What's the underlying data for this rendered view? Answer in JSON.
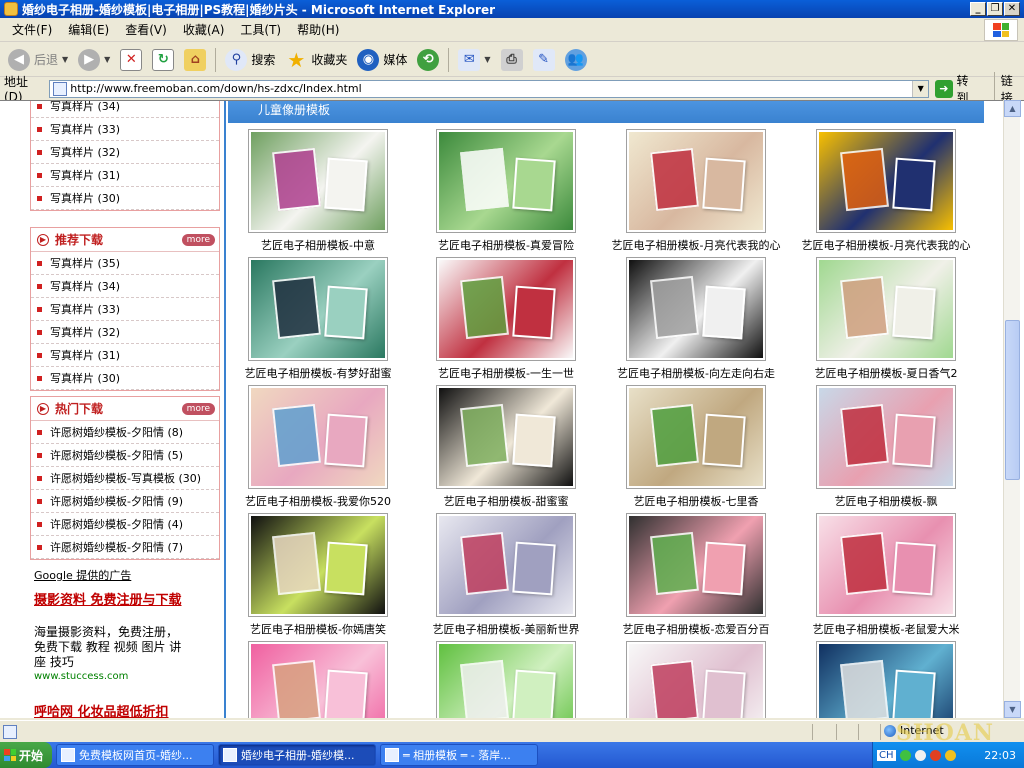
{
  "window": {
    "title": "婚纱电子相册-婚纱模板|电子相册|PS教程|婚纱片头 - Microsoft Internet Explorer",
    "min": "_",
    "max": "❐",
    "close": "✕"
  },
  "menu": [
    "文件(F)",
    "编辑(E)",
    "查看(V)",
    "收藏(A)",
    "工具(T)",
    "帮助(H)"
  ],
  "toolbar": {
    "back": "后退",
    "search": "搜索",
    "favorites": "收藏夹",
    "media": "媒体"
  },
  "address": {
    "label": "地址(D)",
    "url": "http://www.freemoban.com/down/hs-zdxc/Index.html",
    "go": "转到",
    "links": "链接"
  },
  "sidebar": {
    "top_list": [
      "写真样片 (34)",
      "写真样片 (33)",
      "写真样片 (32)",
      "写真样片 (31)",
      "写真样片 (30)"
    ],
    "recommend": {
      "title": "推荐下载",
      "more": "more",
      "items": [
        "写真样片 (35)",
        "写真样片 (34)",
        "写真样片 (33)",
        "写真样片 (32)",
        "写真样片 (31)",
        "写真样片 (30)"
      ]
    },
    "hot": {
      "title": "热门下载",
      "more": "more",
      "items": [
        "许愿树婚纱模板-夕阳情 (8)",
        "许愿树婚纱模板-夕阳情 (5)",
        "许愿树婚纱模板-写真模板 (30)",
        "许愿树婚纱模板-夕阳情 (9)",
        "许愿树婚纱模板-夕阳情 (4)",
        "许愿树婚纱模板-夕阳情 (7)"
      ]
    },
    "ads": {
      "google": "Google 提供的广告",
      "ad1_title": "摄影资料 免费注册与下载",
      "ad1_desc": "海量摄影资料，免费注册，免费下载 教程 视频 图片 讲座 技巧",
      "ad1_url": "www.stuccess.com",
      "ad2_title": "呼哈网 化妆品超低折扣"
    }
  },
  "content": {
    "header": "儿童像册模板",
    "thumbs": [
      {
        "caption": "艺匠电子相册模板-中意",
        "c1": "#6fa060",
        "c2": "#f4f4f0",
        "c3": "#b04090"
      },
      {
        "caption": "艺匠电子相册模板-真爱冒险",
        "c1": "#3c8a3c",
        "c2": "#a8d890",
        "c3": "#ffffff"
      },
      {
        "caption": "艺匠电子相册模板-月亮代表我的心",
        "c1": "#f0e8d0",
        "c2": "#d8b8a0",
        "c3": "#c03040"
      },
      {
        "caption": "艺匠电子相册模板-月亮代表我的心",
        "c1": "#f8c000",
        "c2": "#203070",
        "c3": "#e06010"
      },
      {
        "caption": "艺匠电子相册模板-有梦好甜蜜",
        "c1": "#2a7860",
        "c2": "#9ad0c0",
        "c3": "#203040"
      },
      {
        "caption": "艺匠电子相册模板-一生一世",
        "c1": "#fafafa",
        "c2": "#c03040",
        "c3": "#60a040"
      },
      {
        "caption": "艺匠电子相册模板-向左走向右走",
        "c1": "#101010",
        "c2": "#f0f0f0",
        "c3": "#a0a0a0"
      },
      {
        "caption": "艺匠电子相册模板-夏日香气2",
        "c1": "#a0d890",
        "c2": "#f0f0e8",
        "c3": "#d0a080"
      },
      {
        "caption": "艺匠电子相册模板-我爱你520",
        "c1": "#f0d8c0",
        "c2": "#e8a8c0",
        "c3": "#60a0d0"
      },
      {
        "caption": "艺匠电子相册模板-甜蜜蜜",
        "c1": "#101010",
        "c2": "#f0e8d8",
        "c3": "#80b060"
      },
      {
        "caption": "艺匠电子相册模板-七里香",
        "c1": "#e8e0c8",
        "c2": "#c0a880",
        "c3": "#50a040"
      },
      {
        "caption": "艺匠电子相册模板-飘",
        "c1": "#c8d8e8",
        "c2": "#e8a0b0",
        "c3": "#c03040"
      },
      {
        "caption": "艺匠电子相册模板-你嫣唐笑",
        "c1": "#101010",
        "c2": "#c8e060",
        "c3": "#e8d8c0"
      },
      {
        "caption": "艺匠电子相册模板-美丽新世界",
        "c1": "#e8e8f0",
        "c2": "#a0a0c0",
        "c3": "#c04060"
      },
      {
        "caption": "艺匠电子相册模板-恋爱百分百",
        "c1": "#303030",
        "c2": "#f0a0b0",
        "c3": "#60b050"
      },
      {
        "caption": "艺匠电子相册模板-老鼠爱大米",
        "c1": "#f8e0e8",
        "c2": "#e890b0",
        "c3": "#c03040"
      },
      {
        "caption": "",
        "c1": "#f060a0",
        "c2": "#f8c0d8",
        "c3": "#d8a080"
      },
      {
        "caption": "",
        "c1": "#60c040",
        "c2": "#d0f0c0",
        "c3": "#f0f0f0"
      },
      {
        "caption": "",
        "c1": "#f8f8f8",
        "c2": "#e0c0d0",
        "c3": "#c04060"
      },
      {
        "caption": "",
        "c1": "#103060",
        "c2": "#60b0d0",
        "c3": "#e0e0e0"
      }
    ]
  },
  "status": {
    "zone": "Internet"
  },
  "taskbar": {
    "start": "开始",
    "tasks": [
      "免费模板网首页-婚纱...",
      "婚纱电子相册-婚纱模...",
      "═ 相册模板 ═ - 落岸..."
    ],
    "lang": "CH",
    "clock": "22:03"
  },
  "watermark": "SHOAN"
}
